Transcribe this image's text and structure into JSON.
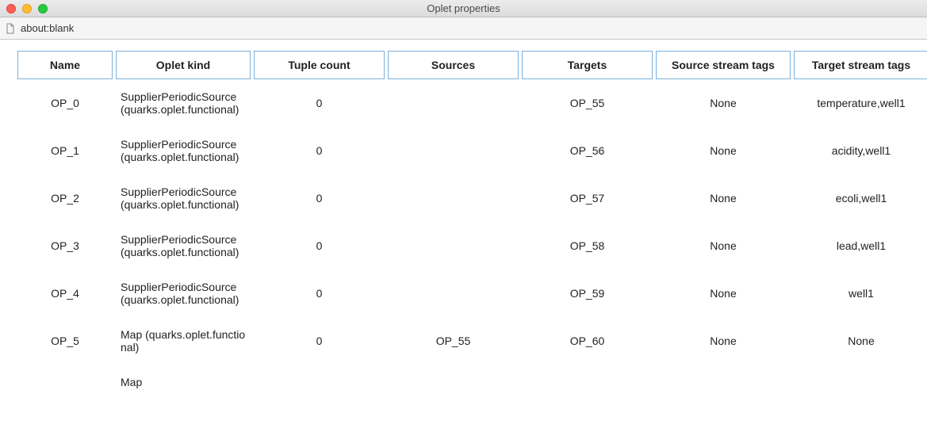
{
  "window": {
    "title": "Oplet properties"
  },
  "address": {
    "text": "about:blank"
  },
  "table": {
    "headers": {
      "name": "Name",
      "kind": "Oplet kind",
      "tuple": "Tuple count",
      "sources": "Sources",
      "targets": "Targets",
      "stags": "Source stream tags",
      "ttags": "Target stream tags"
    },
    "rows": [
      {
        "name": "OP_0",
        "kind": "SupplierPeriodicSource (quarks.oplet.functional)",
        "tuple": "0",
        "sources": "",
        "targets": "OP_55",
        "stags": "None",
        "ttags": "temperature,well1"
      },
      {
        "name": "OP_1",
        "kind": "SupplierPeriodicSource (quarks.oplet.functional)",
        "tuple": "0",
        "sources": "",
        "targets": "OP_56",
        "stags": "None",
        "ttags": "acidity,well1"
      },
      {
        "name": "OP_2",
        "kind": "SupplierPeriodicSource (quarks.oplet.functional)",
        "tuple": "0",
        "sources": "",
        "targets": "OP_57",
        "stags": "None",
        "ttags": "ecoli,well1"
      },
      {
        "name": "OP_3",
        "kind": "SupplierPeriodicSource (quarks.oplet.functional)",
        "tuple": "0",
        "sources": "",
        "targets": "OP_58",
        "stags": "None",
        "ttags": "lead,well1"
      },
      {
        "name": "OP_4",
        "kind": "SupplierPeriodicSource (quarks.oplet.functional)",
        "tuple": "0",
        "sources": "",
        "targets": "OP_59",
        "stags": "None",
        "ttags": "well1"
      },
      {
        "name": "OP_5",
        "kind": "Map (quarks.oplet.functional)",
        "tuple": "0",
        "sources": "OP_55",
        "targets": "OP_60",
        "stags": "None",
        "ttags": "None"
      }
    ],
    "partial_next": {
      "kind_fragment": "Map"
    }
  }
}
